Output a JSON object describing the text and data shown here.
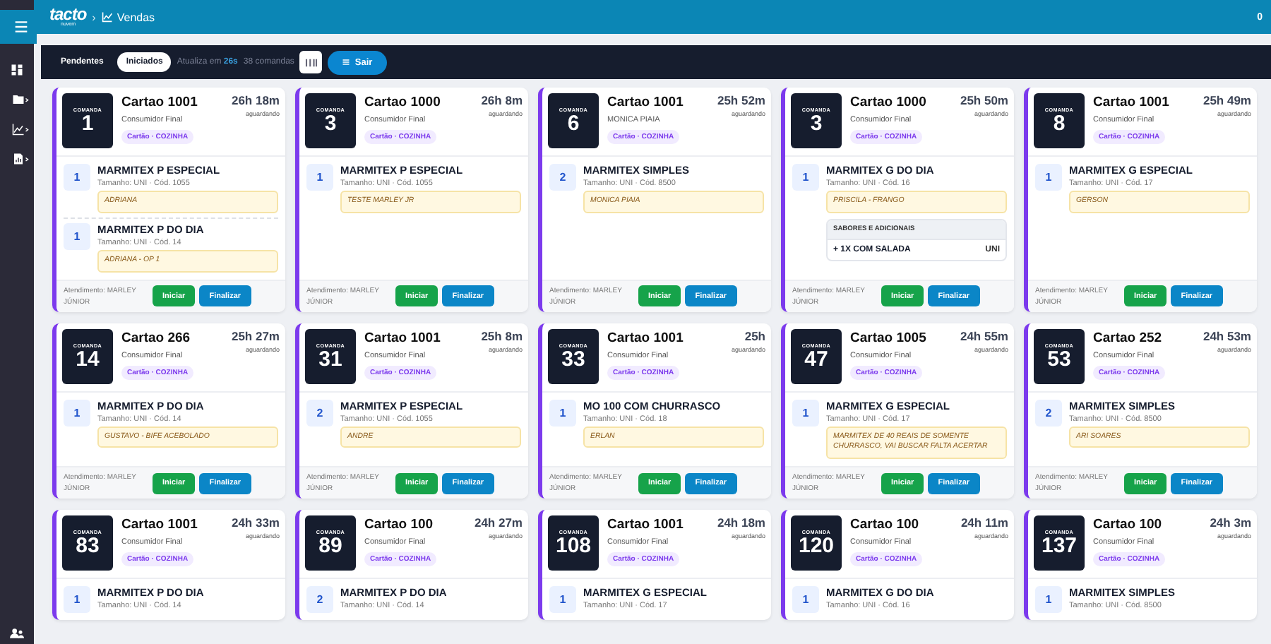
{
  "header": {
    "logo": "tacto",
    "logo_tagline": "nuvem",
    "separator": "›",
    "breadcrumb": "Vendas",
    "counter": "0"
  },
  "toolbar": {
    "tabs": [
      {
        "label": "Pendentes",
        "selected": false
      },
      {
        "label": "Iniciados",
        "selected": true
      }
    ],
    "refresh": "Atualiza em **26s**",
    "count": "38 comandas",
    "exit": "Sair"
  },
  "cards": [
    {
      "label": "COMANDA",
      "number": "1",
      "title": "Cartao 1001",
      "customer": "Consumidor Final",
      "tag": "Cartão · COZINHA",
      "time": "26h 18m",
      "status": "aguardando",
      "items": [
        {
          "qty": "1",
          "name": "MARMITEX P ESPECIAL",
          "meta": "Tamanho: UNI · Cód. 1055",
          "note": "ADRIANA"
        },
        {
          "qty": "1",
          "name": "MARMITEX P DO DIA",
          "meta": "Tamanho: UNI · Cód. 14",
          "note": "ADRIANA - OP 1"
        }
      ],
      "footer": {
        "attendant": "Atendimento: MARLEY JÚNIOR",
        "start": "Iniciar",
        "finish": "Finalizar"
      }
    },
    {
      "label": "COMANDA",
      "number": "3",
      "title": "Cartao 1000",
      "customer": "Consumidor Final",
      "tag": "Cartão · COZINHA",
      "time": "26h 8m",
      "status": "aguardando",
      "items": [
        {
          "qty": "1",
          "name": "MARMITEX P ESPECIAL",
          "meta": "Tamanho: UNI · Cód. 1055",
          "note": "TESTE MARLEY JR"
        }
      ],
      "footer": {
        "attendant": "Atendimento: MARLEY JÚNIOR",
        "start": "Iniciar",
        "finish": "Finalizar"
      }
    },
    {
      "label": "COMANDA",
      "number": "6",
      "title": "Cartao 1001",
      "customer": "MONICA PIAIA",
      "tag": "Cartão · COZINHA",
      "time": "25h 52m",
      "status": "aguardando",
      "items": [
        {
          "qty": "2",
          "name": "MARMITEX SIMPLES",
          "meta": "Tamanho: UNI · Cód. 8500",
          "note": "MONICA PIAIA"
        }
      ],
      "footer": {
        "attendant": "Atendimento: MARLEY JÚNIOR",
        "start": "Iniciar",
        "finish": "Finalizar"
      }
    },
    {
      "label": "COMANDA",
      "number": "3",
      "title": "Cartao 1000",
      "customer": "Consumidor Final",
      "tag": "Cartão · COZINHA",
      "time": "25h 50m",
      "status": "aguardando",
      "items": [
        {
          "qty": "1",
          "name": "MARMITEX G DO DIA",
          "meta": "Tamanho: UNI · Cód. 16",
          "note": "PRISCILA - FRANGO",
          "addons": {
            "title": "SABORES E ADICIONAIS",
            "rows": [
              {
                "name": "+ 1X COM SALADA",
                "unit": "UNI"
              }
            ]
          }
        }
      ],
      "footer": {
        "attendant": "Atendimento: MARLEY JÚNIOR",
        "start": "Iniciar",
        "finish": "Finalizar"
      }
    },
    {
      "label": "COMANDA",
      "number": "8",
      "title": "Cartao 1001",
      "customer": "Consumidor Final",
      "tag": "Cartão · COZINHA",
      "time": "25h 49m",
      "status": "aguardando",
      "items": [
        {
          "qty": "1",
          "name": "MARMITEX G ESPECIAL",
          "meta": "Tamanho: UNI · Cód. 17",
          "note": "GERSON"
        }
      ],
      "footer": {
        "attendant": "Atendimento: MARLEY JÚNIOR",
        "start": "Iniciar",
        "finish": "Finalizar"
      }
    },
    {
      "label": "COMANDA",
      "number": "14",
      "title": "Cartao 266",
      "customer": "Consumidor Final",
      "tag": "Cartão · COZINHA",
      "time": "25h 27m",
      "status": "aguardando",
      "items": [
        {
          "qty": "1",
          "name": "MARMITEX P DO DIA",
          "meta": "Tamanho: UNI · Cód. 14",
          "note": "GUSTAVO - BIFE ACEBOLADO"
        }
      ],
      "footer": {
        "attendant": "Atendimento: MARLEY JÚNIOR",
        "start": "Iniciar",
        "finish": "Finalizar"
      }
    },
    {
      "label": "COMANDA",
      "number": "31",
      "title": "Cartao 1001",
      "customer": "Consumidor Final",
      "tag": "Cartão · COZINHA",
      "time": "25h 8m",
      "status": "aguardando",
      "items": [
        {
          "qty": "2",
          "name": "MARMITEX P ESPECIAL",
          "meta": "Tamanho: UNI · Cód. 1055",
          "note": "ANDRE"
        }
      ],
      "footer": {
        "attendant": "Atendimento: MARLEY JÚNIOR",
        "start": "Iniciar",
        "finish": "Finalizar"
      }
    },
    {
      "label": "COMANDA",
      "number": "33",
      "title": "Cartao 1001",
      "customer": "Consumidor Final",
      "tag": "Cartão · COZINHA",
      "time": "25h",
      "status": "aguardando",
      "items": [
        {
          "qty": "1",
          "name": "MO 100 COM CHURRASCO",
          "meta": "Tamanho: UNI · Cód. 18",
          "note": "ERLAN"
        }
      ],
      "footer": {
        "attendant": "Atendimento: MARLEY JÚNIOR",
        "start": "Iniciar",
        "finish": "Finalizar"
      }
    },
    {
      "label": "COMANDA",
      "number": "47",
      "title": "Cartao 1005",
      "customer": "Consumidor Final",
      "tag": "Cartão · COZINHA",
      "time": "24h 55m",
      "status": "aguardando",
      "items": [
        {
          "qty": "1",
          "name": "MARMITEX G ESPECIAL",
          "meta": "Tamanho: UNI · Cód. 17",
          "note": "MARMITEX DE 40 REAIS DE SOMENTE CHURRASCO, VAI BUSCAR FALTA ACERTAR"
        }
      ],
      "footer": {
        "attendant": "Atendimento: MARLEY JÚNIOR",
        "start": "Iniciar",
        "finish": "Finalizar"
      }
    },
    {
      "label": "COMANDA",
      "number": "53",
      "title": "Cartao 252",
      "customer": "Consumidor Final",
      "tag": "Cartão · COZINHA",
      "time": "24h 53m",
      "status": "aguardando",
      "items": [
        {
          "qty": "2",
          "name": "MARMITEX SIMPLES",
          "meta": "Tamanho: UNI · Cód. 8500",
          "note": "ARI SOARES"
        }
      ],
      "footer": {
        "attendant": "Atendimento: MARLEY JÚNIOR",
        "start": "Iniciar",
        "finish": "Finalizar"
      }
    },
    {
      "label": "COMANDA",
      "number": "83",
      "title": "Cartao 1001",
      "customer": "Consumidor Final",
      "tag": "Cartão · COZINHA",
      "time": "24h 33m",
      "status": "aguardando",
      "items": [
        {
          "qty": "1",
          "name": "MARMITEX P DO DIA",
          "meta": "Tamanho: UNI · Cód. 14"
        }
      ]
    },
    {
      "label": "COMANDA",
      "number": "89",
      "title": "Cartao 100",
      "customer": "Consumidor Final",
      "tag": "Cartão · COZINHA",
      "time": "24h 27m",
      "status": "aguardando",
      "items": [
        {
          "qty": "2",
          "name": "MARMITEX P DO DIA",
          "meta": "Tamanho: UNI · Cód. 14"
        }
      ]
    },
    {
      "label": "COMANDA",
      "number": "108",
      "title": "Cartao 1001",
      "customer": "Consumidor Final",
      "tag": "Cartão · COZINHA",
      "time": "24h 18m",
      "status": "aguardando",
      "items": [
        {
          "qty": "1",
          "name": "MARMITEX G ESPECIAL",
          "meta": "Tamanho: UNI · Cód. 17"
        }
      ]
    },
    {
      "label": "COMANDA",
      "number": "120",
      "title": "Cartao 100",
      "customer": "Consumidor Final",
      "tag": "Cartão · COZINHA",
      "time": "24h 11m",
      "status": "aguardando",
      "items": [
        {
          "qty": "1",
          "name": "MARMITEX G DO DIA",
          "meta": "Tamanho: UNI · Cód. 16"
        }
      ]
    },
    {
      "label": "COMANDA",
      "number": "137",
      "title": "Cartao 100",
      "customer": "Consumidor Final",
      "tag": "Cartão · COZINHA",
      "time": "24h 3m",
      "status": "aguardando",
      "items": [
        {
          "qty": "1",
          "name": "MARMITEX SIMPLES",
          "meta": "Tamanho: UNI · Cód. 8500"
        }
      ]
    }
  ]
}
